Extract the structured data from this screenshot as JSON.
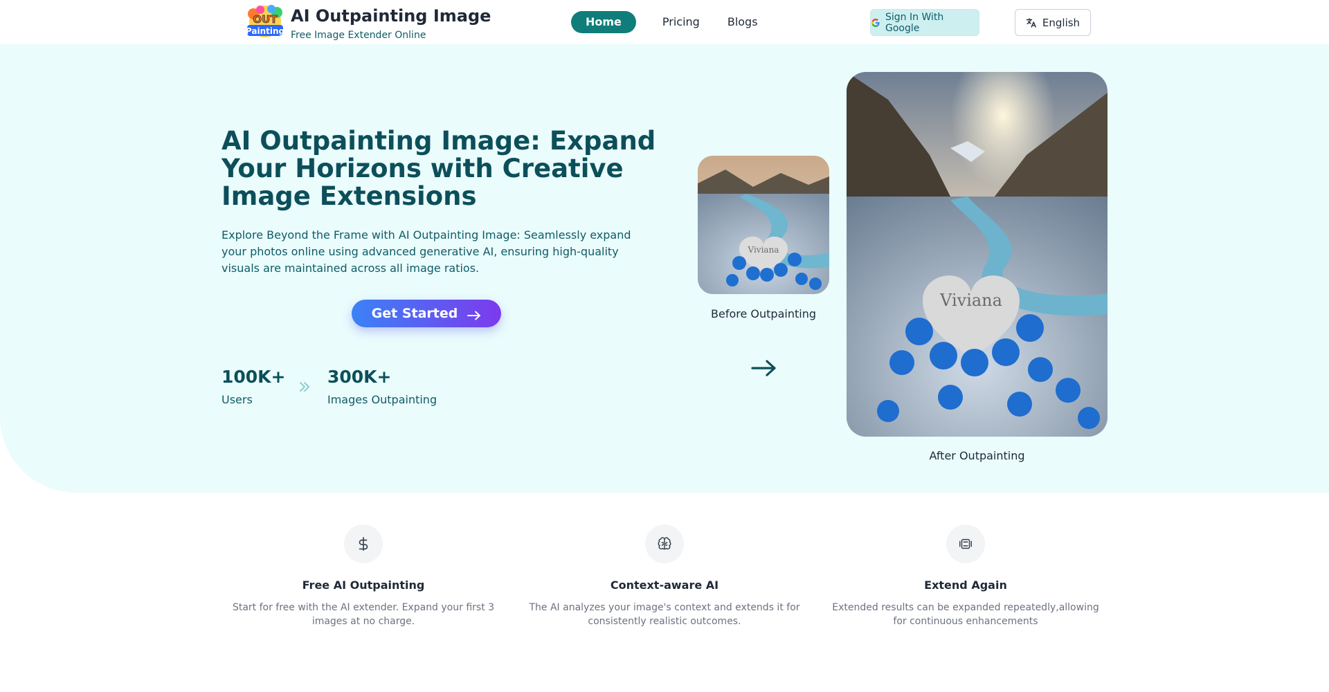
{
  "header": {
    "brand_title": "AI Outpainting Image",
    "brand_subtitle": "Free Image Extender Online",
    "nav": [
      {
        "label": "Home",
        "active": true
      },
      {
        "label": "Pricing",
        "active": false
      },
      {
        "label": "Blogs",
        "active": false
      }
    ],
    "signin_label": "Sign In With Google",
    "language_label": "English"
  },
  "hero": {
    "title": "AI Outpainting Image: Expand Your Horizons with Creative Image Extensions",
    "description": "Explore Beyond the Frame with AI Outpainting Image: Seamlessly expand your photos online using advanced generative AI, ensuring high-quality visuals are maintained across all image ratios.",
    "cta_label": "Get Started",
    "stats": [
      {
        "value": "100K+",
        "label": "Users"
      },
      {
        "value": "300K+",
        "label": "Images Outpainting"
      }
    ],
    "before_caption": "Before Outpainting",
    "after_caption": "After Outpainting",
    "image_text": "Viviana"
  },
  "features": [
    {
      "icon": "dollar-icon",
      "title": "Free AI Outpainting",
      "description": "Start for free with the AI extender. Expand your first 3 images at no charge."
    },
    {
      "icon": "brain-icon",
      "title": "Context-aware AI",
      "description": "The AI analyzes your image's context and extends it for consistently realistic outcomes."
    },
    {
      "icon": "layers-icon",
      "title": "Extend Again",
      "description": "Extended results can be expanded repeatedly,allowing for continuous enhancements"
    }
  ],
  "colors": {
    "primary": "#0f7e7a",
    "hero_bg": "#eafcfc",
    "heading": "#0c4f5a",
    "cta_gradient_start": "#3b82f6",
    "cta_gradient_end": "#7c3aed"
  }
}
